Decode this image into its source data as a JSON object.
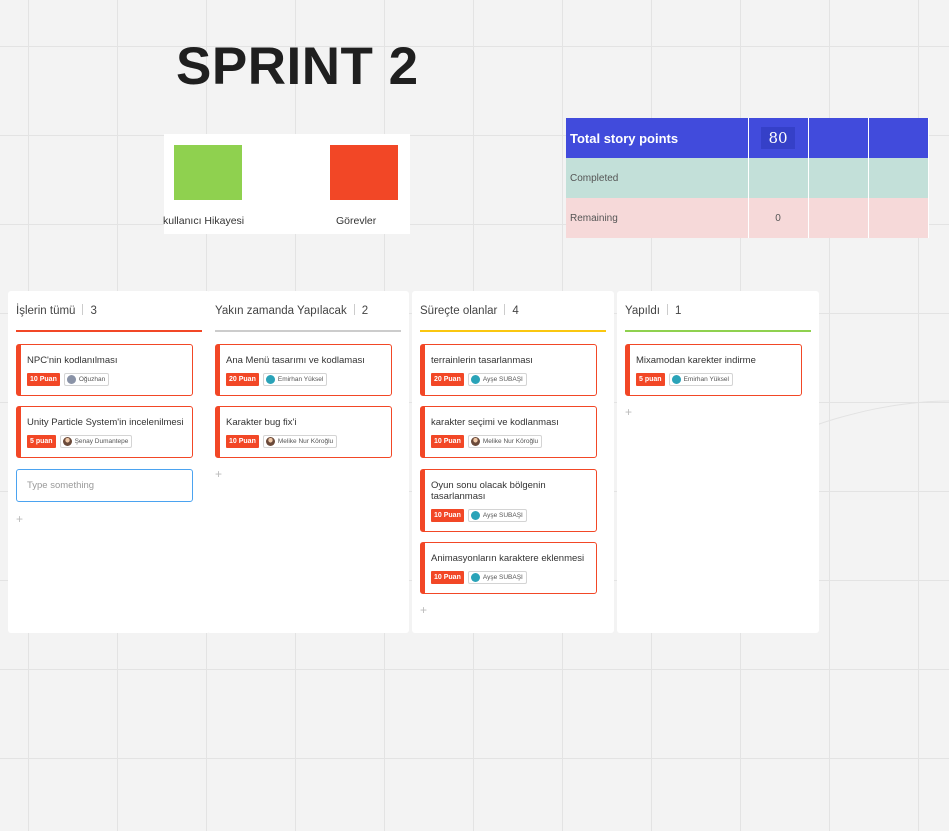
{
  "title": "SPRINT 2",
  "legend": [
    {
      "label": "kullanıcı Hikayesi",
      "color": "#8fd14f"
    },
    {
      "label": "Görevler",
      "color": "#f24726"
    }
  ],
  "story_table": {
    "total_label": "Total story points",
    "total_value": "80",
    "completed_label": "Completed",
    "remaining_label": "Remaining",
    "remaining_value": "0"
  },
  "columns": [
    {
      "name": "İşlerin tümü",
      "count": "3",
      "color": "#f24726",
      "cards": [
        {
          "title": "NPC'nin kodlanılması",
          "points": "10 Puan",
          "assignee": "Oğuzhan"
        },
        {
          "title": "Unity Particle System'in incelenilmesi",
          "points": "5 puan",
          "assignee": "Şenay Dumantepe"
        }
      ],
      "input_placeholder": "Type something",
      "add": "+"
    },
    {
      "name": "Yakın zamanda Yapılacak",
      "count": "2",
      "color": "#cccccc",
      "cards": [
        {
          "title": "Ana Menü tasarımı ve kodlaması",
          "points": "20 Puan",
          "assignee": "Emirhan Yüksel"
        },
        {
          "title": "Karakter bug fix'i",
          "points": "10 Puan",
          "assignee": "Melike Nur Köroğlu"
        }
      ],
      "add": "+"
    },
    {
      "name": "Süreçte olanlar",
      "count": "4",
      "color": "#fac710",
      "cards": [
        {
          "title": "terrainlerin tasarlanması",
          "points": "20 Puan",
          "assignee": "Ayşe SUBAŞI"
        },
        {
          "title": "karakter seçimi ve kodlanması",
          "points": "10 Puan",
          "assignee": "Melike Nur Köroğlu"
        },
        {
          "title": "Oyun sonu olacak bölgenin tasarlanması",
          "points": "10 Puan",
          "assignee": "Ayşe SUBAŞI"
        },
        {
          "title": "Animasyonların karaktere eklenmesi",
          "points": "10 Puan",
          "assignee": "Ayşe SUBAŞI"
        }
      ],
      "add": "+"
    },
    {
      "name": "Yapıldı",
      "count": "1",
      "color": "#8fd14f",
      "cards": [
        {
          "title": "Mixamodan karekter indirme",
          "points": "5 puan",
          "assignee": "Emirhan Yüksel"
        }
      ],
      "add": "+"
    }
  ]
}
